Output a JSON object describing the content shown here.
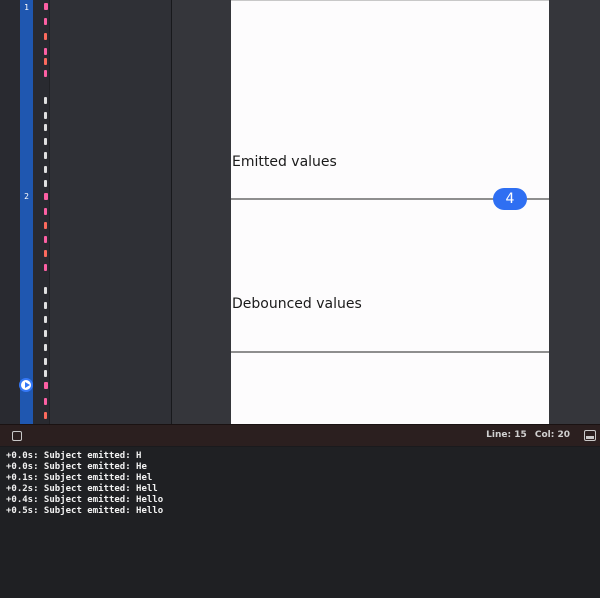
{
  "editor": {
    "line_markers": [
      "1",
      "2"
    ],
    "gutter_color": "#1f57b0",
    "run_icon": "play-circle-icon"
  },
  "live_view": {
    "sections": [
      {
        "label": "Emitted values"
      },
      {
        "label": "Debounced values"
      }
    ],
    "emitted_marble": "4",
    "marble_color": "#2f6ff2"
  },
  "debug_bar": {
    "toggle_icon": "square-icon",
    "line_text": "Line: 15",
    "col_text": "Col: 20",
    "panel_icon": "bottom-panel-icon"
  },
  "console": {
    "lines": [
      "+0.0s: Subject emitted: H",
      "+0.0s: Subject emitted: He",
      "+0.1s: Subject emitted: Hel",
      "+0.2s: Subject emitted: Hell",
      "+0.4s: Subject emitted: Hello",
      "+0.5s: Subject emitted: Hello"
    ]
  }
}
